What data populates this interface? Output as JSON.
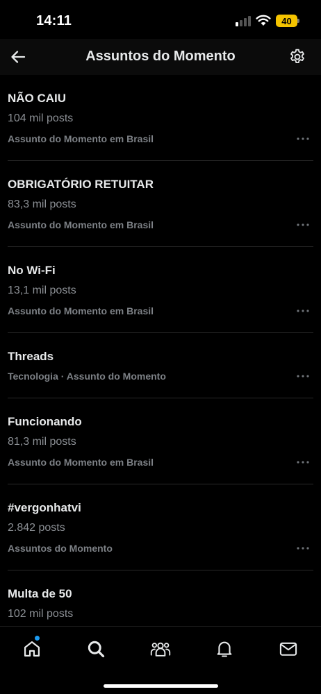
{
  "status_bar": {
    "time": "14:11",
    "battery": "40"
  },
  "header": {
    "title": "Assuntos do Momento",
    "back_icon": "arrow-left-icon",
    "settings_icon": "gear-icon"
  },
  "trends": [
    {
      "name": "NÃO CAIU",
      "posts": "104 mil posts",
      "context": "Assunto do Momento em Brasil"
    },
    {
      "name": "OBRIGATÓRIO RETUITAR",
      "posts": "83,3 mil posts",
      "context": "Assunto do Momento em Brasil"
    },
    {
      "name": "No Wi-Fi",
      "posts": "13,1 mil posts",
      "context": "Assunto do Momento em Brasil"
    },
    {
      "name": "Threads",
      "context": "Tecnologia · Assunto do Momento"
    },
    {
      "name": "Funcionando",
      "posts": "81,3 mil posts",
      "context": "Assunto do Momento em Brasil"
    },
    {
      "name": "#vergonhatvi",
      "posts": "2.842 posts",
      "context": "Assuntos do Momento"
    },
    {
      "name": "Multa de 50",
      "posts": "102 mil posts"
    }
  ],
  "bottom_nav": {
    "items": [
      "home-icon",
      "search-icon",
      "communities-icon",
      "bell-icon",
      "mail-icon"
    ],
    "accent": "#1d9bf0"
  },
  "colors": {
    "background": "#000000",
    "text_primary": "#e7e9ea",
    "text_secondary": "#8b8f94",
    "battery": "#f5c400"
  }
}
